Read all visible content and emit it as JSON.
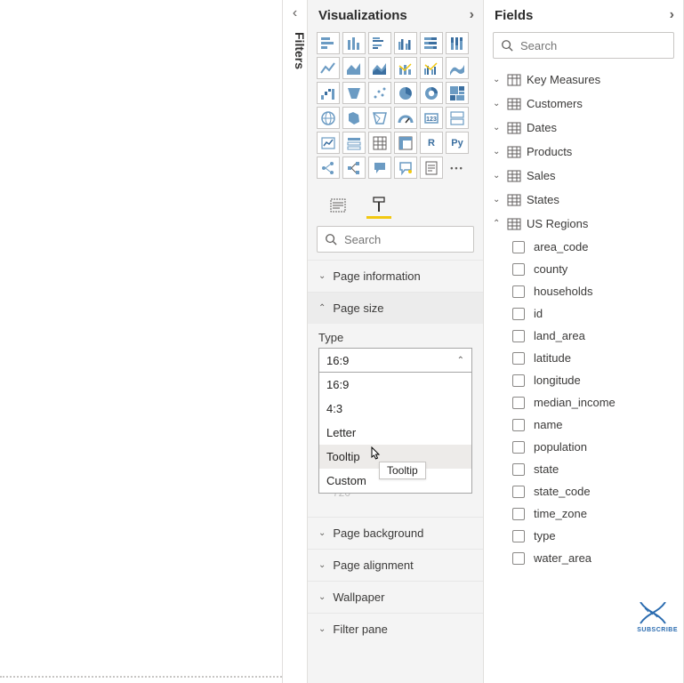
{
  "filters": {
    "label": "Filters"
  },
  "viz": {
    "header": "Visualizations",
    "tabs": {
      "fields": "fields",
      "format": "format"
    },
    "search_placeholder": "Search",
    "sections": {
      "page_info": "Page information",
      "page_size": "Page size",
      "page_bg": "Page background",
      "page_align": "Page alignment",
      "wallpaper": "Wallpaper",
      "filter_pane": "Filter pane"
    },
    "page_size": {
      "type_label": "Type",
      "selected": "16:9",
      "options": [
        "16:9",
        "4:3",
        "Letter",
        "Tooltip",
        "Custom"
      ],
      "tooltip_hint": "Tooltip",
      "height_ghost": "720"
    }
  },
  "fields": {
    "header": "Fields",
    "search_placeholder": "Search",
    "tables": [
      {
        "name": "Key Measures",
        "expanded": false,
        "icon": "measure"
      },
      {
        "name": "Customers",
        "expanded": false,
        "icon": "table"
      },
      {
        "name": "Dates",
        "expanded": false,
        "icon": "table"
      },
      {
        "name": "Products",
        "expanded": false,
        "icon": "table"
      },
      {
        "name": "Sales",
        "expanded": false,
        "icon": "table"
      },
      {
        "name": "States",
        "expanded": false,
        "icon": "table"
      },
      {
        "name": "US Regions",
        "expanded": true,
        "icon": "table",
        "columns": [
          "area_code",
          "county",
          "households",
          "id",
          "land_area",
          "latitude",
          "longitude",
          "median_income",
          "name",
          "population",
          "state",
          "state_code",
          "time_zone",
          "type",
          "water_area"
        ]
      }
    ]
  },
  "badge": {
    "subscribe": "SUBSCRIBE"
  }
}
